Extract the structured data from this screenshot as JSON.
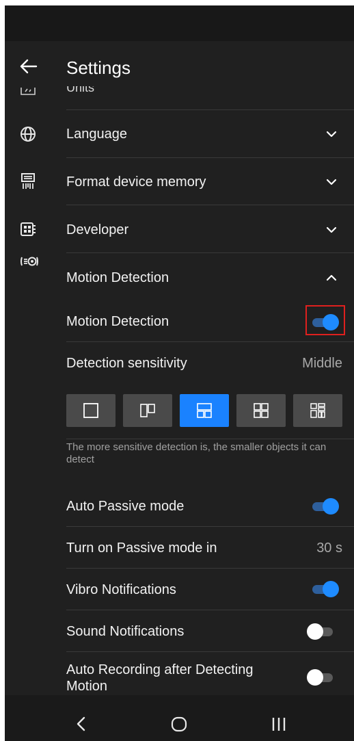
{
  "header": {
    "title": "Settings"
  },
  "menu": {
    "units_cut": "Units",
    "language": "Language",
    "format_memory": "Format device memory",
    "developer": "Developer",
    "motion_detection": "Motion Detection"
  },
  "motion": {
    "toggle_label": "Motion Detection",
    "toggle_on": true,
    "sensitivity_label": "Detection sensitivity",
    "sensitivity_value": "Middle",
    "sensitivity_levels": 5,
    "sensitivity_selected_index": 2,
    "hint": "The more sensitive detection is, the smaller objects it can detect",
    "auto_passive_label": "Auto Passive mode",
    "auto_passive_on": true,
    "passive_in_label": "Turn on Passive mode in",
    "passive_in_value": "30 s",
    "vibro_label": "Vibro Notifications",
    "vibro_on": true,
    "sound_label": "Sound Notifications",
    "sound_on": false,
    "auto_rec_label": "Auto Recording after Detecting Motion",
    "auto_rec_on": false
  },
  "colors": {
    "accent": "#1e8bff",
    "background": "#202020",
    "highlight": "#e0201e"
  },
  "icons": [
    "back-arrow-icon",
    "globe-icon",
    "memory-chip-icon",
    "developer-board-icon",
    "motion-sensor-icon",
    "chevron-down-icon",
    "chevron-up-icon",
    "nav-back-icon",
    "nav-home-icon",
    "nav-recents-icon"
  ]
}
